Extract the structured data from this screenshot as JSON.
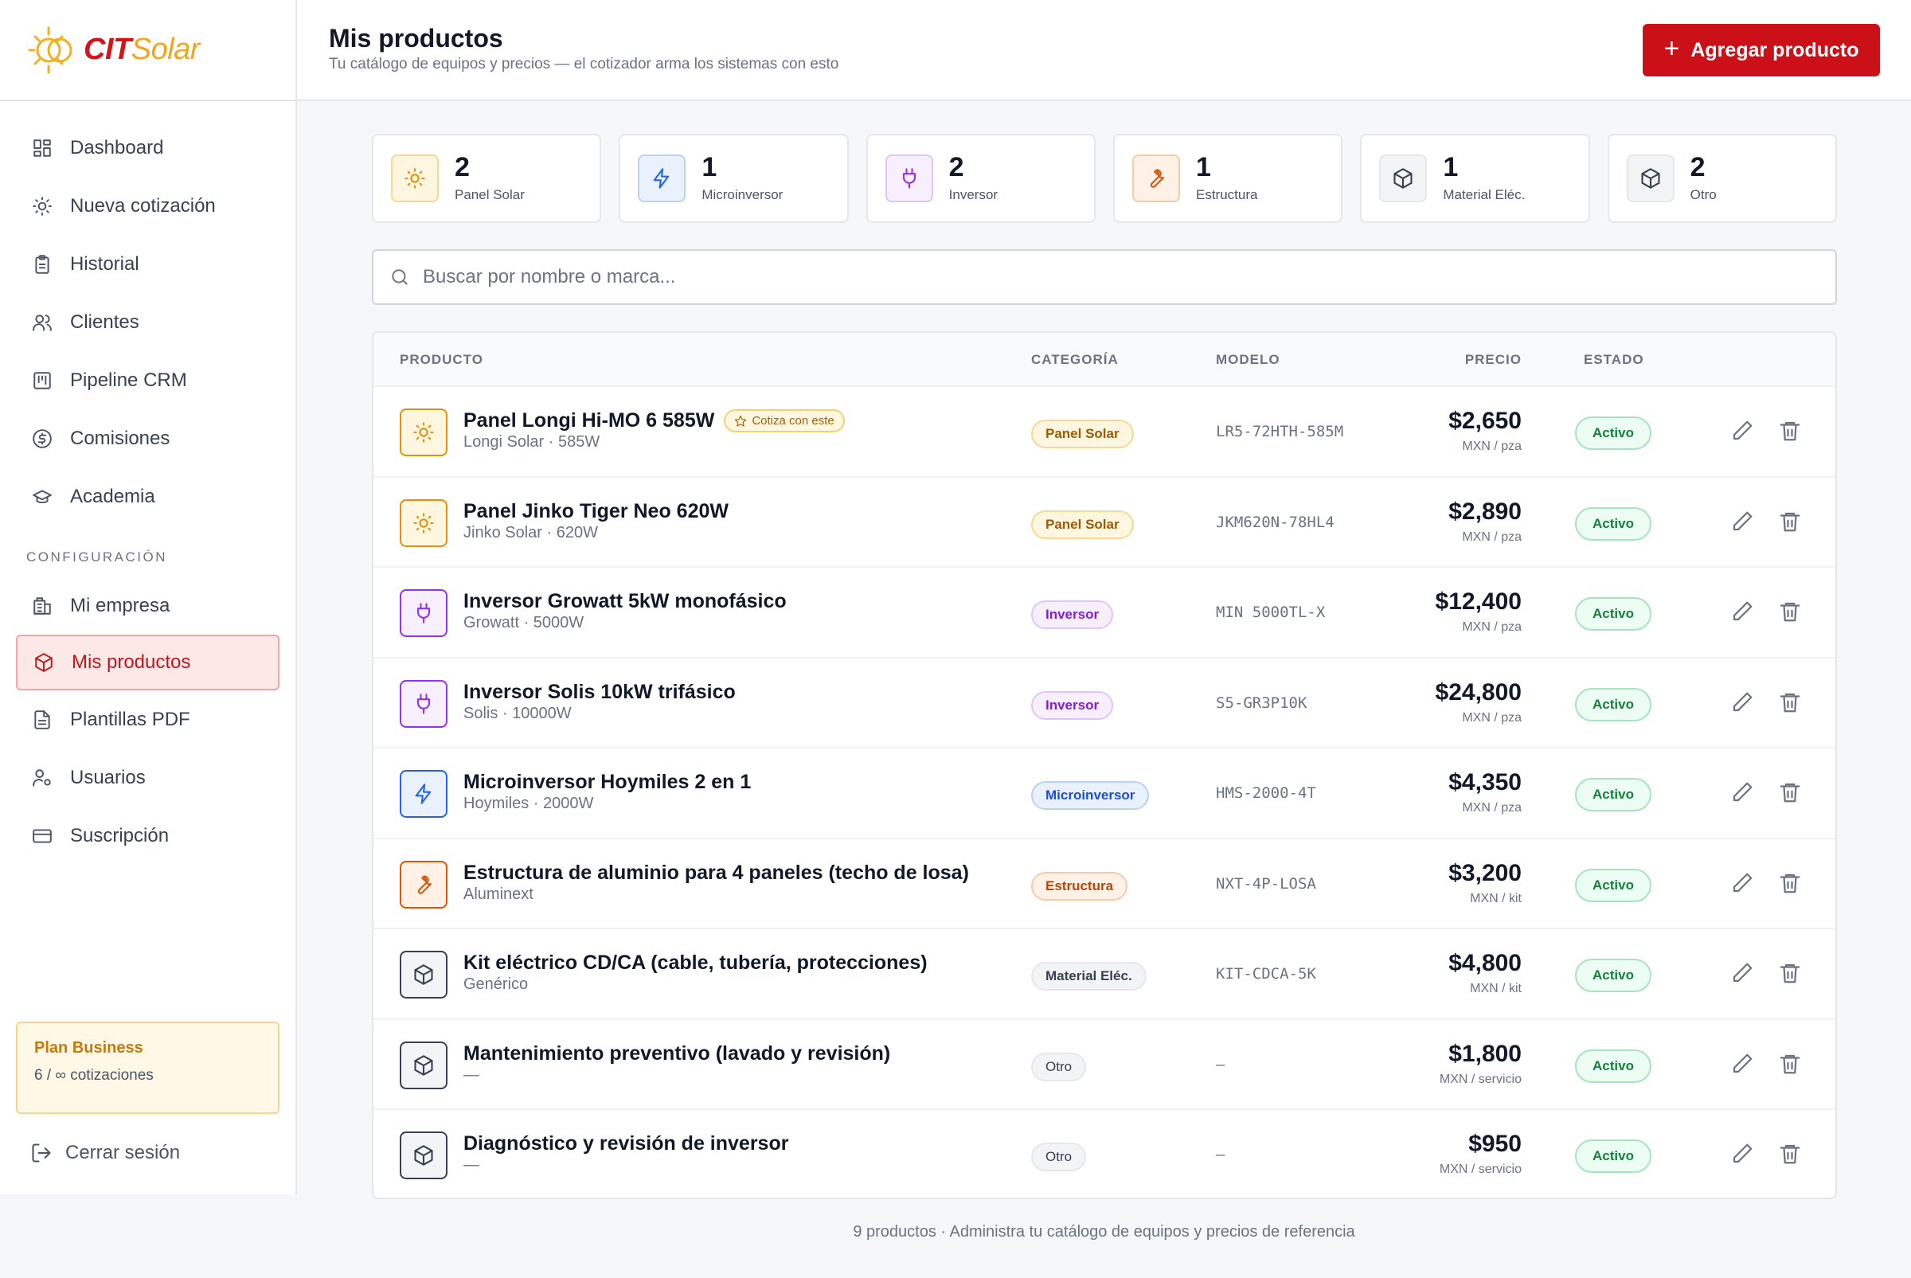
{
  "brand": {
    "cit": "CIT",
    "solar": "Solar"
  },
  "nav": {
    "items": [
      {
        "label": "Dashboard",
        "icon": "grid-icon"
      },
      {
        "label": "Nueva cotización",
        "icon": "sun-icon"
      },
      {
        "label": "Historial",
        "icon": "clipboard-icon"
      },
      {
        "label": "Clientes",
        "icon": "users-icon"
      },
      {
        "label": "Pipeline CRM",
        "icon": "kanban-icon"
      },
      {
        "label": "Comisiones",
        "icon": "dollar-circle-icon"
      },
      {
        "label": "Academia",
        "icon": "graduation-cap-icon"
      }
    ],
    "section": "CONFIGURACIÓN",
    "config_items": [
      {
        "label": "Mi empresa",
        "icon": "building-icon"
      },
      {
        "label": "Mis productos",
        "icon": "package-icon",
        "active": true
      },
      {
        "label": "Plantillas PDF",
        "icon": "file-icon"
      },
      {
        "label": "Usuarios",
        "icon": "user-cog-icon"
      },
      {
        "label": "Suscripción",
        "icon": "credit-card-icon"
      }
    ]
  },
  "plan": {
    "name": "Plan Business",
    "usage": "6 / ∞ cotizaciones"
  },
  "logout": "Cerrar sesión",
  "header": {
    "title": "Mis productos",
    "subtitle": "Tu catálogo de equipos y precios — el cotizador arma los sistemas con esto",
    "add_button": "Agregar producto"
  },
  "stats": [
    {
      "count": "2",
      "label": "Panel Solar",
      "icon": "sun-icon",
      "color": "#e0920e"
    },
    {
      "count": "1",
      "label": "Microinversor",
      "icon": "zap-icon",
      "color": "#2563eb"
    },
    {
      "count": "2",
      "label": "Inversor",
      "icon": "plug-icon",
      "color": "#9333ea"
    },
    {
      "count": "1",
      "label": "Estructura",
      "icon": "wrench-icon",
      "color": "#d9560b"
    },
    {
      "count": "1",
      "label": "Material Eléc.",
      "icon": "box-icon",
      "color": "#374151"
    },
    {
      "count": "2",
      "label": "Otro",
      "icon": "box-icon",
      "color": "#374151"
    }
  ],
  "search": {
    "placeholder": "Buscar por nombre o marca..."
  },
  "table": {
    "headers": {
      "product": "PRODUCTO",
      "category": "CATEGORÍA",
      "model": "MODELO",
      "price": "PRECIO",
      "status": "ESTADO"
    },
    "rows": [
      {
        "name": "Panel Longi Hi-MO 6 585W",
        "badge": "Cotiza con este",
        "sub": "Longi Solar · 585W",
        "category": "Panel Solar",
        "model": "LR5-72HTH-585M",
        "price": "$2,650",
        "unit": "MXN / pza",
        "status": "Activo"
      },
      {
        "name": "Panel Jinko Tiger Neo 620W",
        "sub": "Jinko Solar · 620W",
        "category": "Panel Solar",
        "model": "JKM620N-78HL4",
        "price": "$2,890",
        "unit": "MXN / pza",
        "status": "Activo"
      },
      {
        "name": "Inversor Growatt 5kW monofásico",
        "sub": "Growatt · 5000W",
        "category": "Inversor",
        "model": "MIN 5000TL-X",
        "price": "$12,400",
        "unit": "MXN / pza",
        "status": "Activo"
      },
      {
        "name": "Inversor Solis 10kW trifásico",
        "sub": "Solis · 10000W",
        "category": "Inversor",
        "model": "S5-GR3P10K",
        "price": "$24,800",
        "unit": "MXN / pza",
        "status": "Activo"
      },
      {
        "name": "Microinversor Hoymiles 2 en 1",
        "sub": "Hoymiles · 2000W",
        "category": "Microinversor",
        "model": "HMS-2000-4T",
        "price": "$4,350",
        "unit": "MXN / pza",
        "status": "Activo"
      },
      {
        "name": "Estructura de aluminio para 4 paneles (techo de losa)",
        "sub": "Aluminext",
        "category": "Estructura",
        "model": "NXT-4P-LOSA",
        "price": "$3,200",
        "unit": "MXN / kit",
        "status": "Activo"
      },
      {
        "name": "Kit eléctrico CD/CA (cable, tubería, protecciones)",
        "sub": "Genérico",
        "category": "Material Eléc.",
        "model": "KIT-CDCA-5K",
        "price": "$4,800",
        "unit": "MXN / kit",
        "status": "Activo"
      },
      {
        "name": "Mantenimiento preventivo (lavado y revisión)",
        "sub": "—",
        "category": "Otro",
        "model": "—",
        "price": "$1,800",
        "unit": "MXN / servicio",
        "status": "Activo"
      },
      {
        "name": "Diagnóstico y revisión de inversor",
        "sub": "—",
        "category": "Otro",
        "model": "—",
        "price": "$950",
        "unit": "MXN / servicio",
        "status": "Activo"
      }
    ]
  },
  "footer": "9 productos · Administra tu catálogo de equipos y precios de referencia"
}
